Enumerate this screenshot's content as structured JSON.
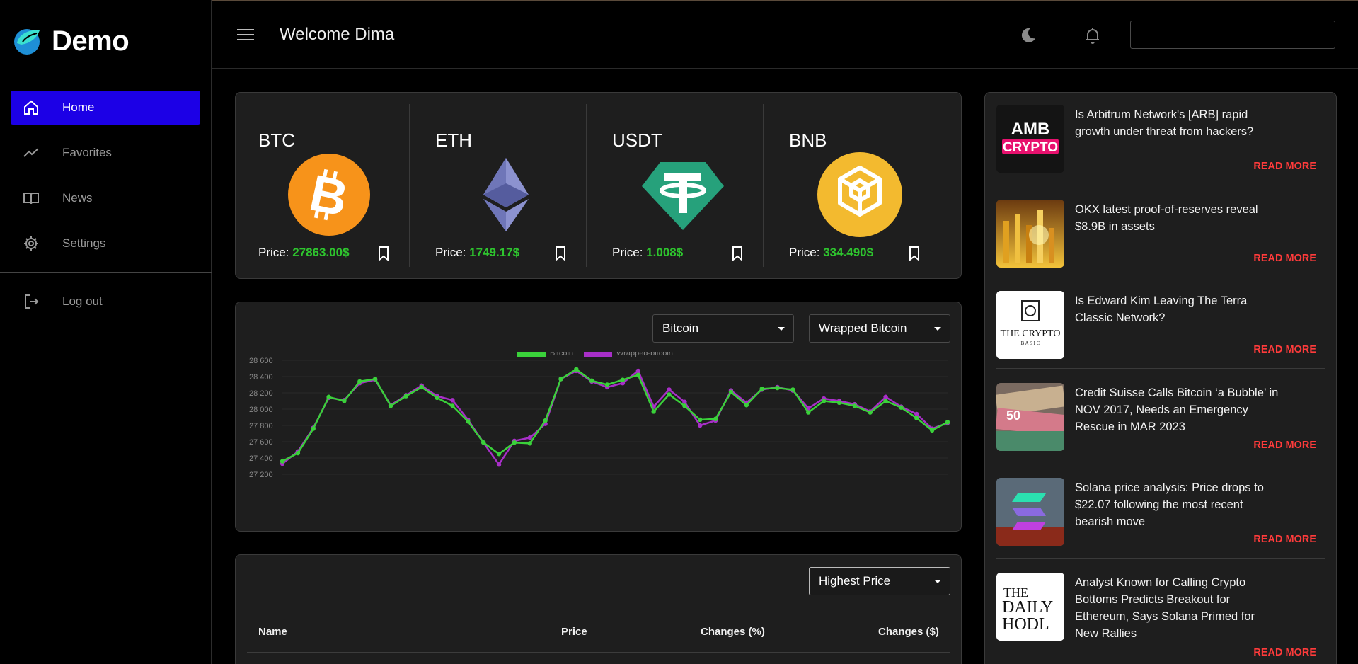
{
  "app": {
    "brand": "Demo"
  },
  "sidebar": {
    "items": [
      {
        "label": "Home",
        "icon": "home-icon",
        "active": true
      },
      {
        "label": "Favorites",
        "icon": "trend-icon",
        "active": false
      },
      {
        "label": "News",
        "icon": "book-icon",
        "active": false
      },
      {
        "label": "Settings",
        "icon": "gear-icon",
        "active": false
      }
    ],
    "logout_label": "Log out"
  },
  "header": {
    "welcome": "Welcome Dima",
    "search_value": ""
  },
  "coins": [
    {
      "symbol": "BTC",
      "price_label": "Price: ",
      "price": "27863.00$",
      "color": "#f7931a"
    },
    {
      "symbol": "ETH",
      "price_label": "Price: ",
      "price": "1749.17$",
      "color": "#627eea"
    },
    {
      "symbol": "USDT",
      "price_label": "Price: ",
      "price": "1.008$",
      "color": "#26a17b"
    },
    {
      "symbol": "BNB",
      "price_label": "Price: ",
      "price": "334.490$",
      "color": "#f3ba2f"
    }
  ],
  "chart_controls": {
    "select_a": "Bitcoin",
    "select_b": "Wrapped Bitcoin"
  },
  "chart_data": {
    "type": "line",
    "ylim": [
      27200,
      28600
    ],
    "yticks": [
      "28 600",
      "28 400",
      "28 200",
      "28 000",
      "27 800",
      "27 600",
      "27 400",
      "27 200"
    ],
    "legend_position": "top",
    "series": [
      {
        "name": "Bitcoin",
        "color": "#3ad13a",
        "values": [
          27360,
          27460,
          27760,
          28150,
          28100,
          28340,
          28370,
          28040,
          28160,
          28270,
          28140,
          28040,
          27850,
          27590,
          27450,
          27590,
          27580,
          27860,
          28370,
          28490,
          28350,
          28300,
          28360,
          28420,
          27970,
          28180,
          28040,
          27870,
          27880,
          28210,
          28050,
          28250,
          28260,
          28240,
          27960,
          28100,
          28080,
          28040,
          27960,
          28100,
          28020,
          27890,
          27740,
          27840
        ]
      },
      {
        "name": "Wrapped-bitcoin",
        "color": "#a82fc8",
        "values": [
          27330,
          27480,
          27770,
          28140,
          28110,
          28320,
          28360,
          28050,
          28170,
          28290,
          28160,
          28110,
          27870,
          27590,
          27320,
          27610,
          27650,
          27820,
          28370,
          28470,
          28340,
          28270,
          28320,
          28470,
          28030,
          28240,
          28090,
          27800,
          27860,
          28230,
          28080,
          28240,
          28270,
          28230,
          28010,
          28130,
          28100,
          28060,
          27970,
          28150,
          28030,
          27940,
          27760,
          27830
        ]
      }
    ]
  },
  "table": {
    "sort_select": "Highest Price",
    "columns": [
      "Name",
      "Price",
      "Changes (%)",
      "Changes ($)"
    ]
  },
  "news": [
    {
      "title": "Is Arbitrum Network's [ARB] rapid growth under threat from hackers?",
      "read_more": "READ MORE",
      "thumb_text_1": "AMB",
      "thumb_text_2": "CRYPTO"
    },
    {
      "title": "OKX latest proof-of-reserves reveal $8.9B in assets",
      "read_more": "READ MORE"
    },
    {
      "title": "Is Edward Kim Leaving The Terra Classic Network?",
      "read_more": "READ MORE",
      "thumb_text_1": "THE CRYPTO",
      "thumb_text_2": "B A S I C"
    },
    {
      "title": "Credit Suisse Calls Bitcoin ‘a Bubble’ in NOV 2017, Needs an Emergency Rescue in MAR 2023",
      "read_more": "READ MORE",
      "thumb_text_1": "50"
    },
    {
      "title": "Solana price analysis: Price drops to $22.07 following the most recent bearish move",
      "read_more": "READ MORE"
    },
    {
      "title": "Analyst Known for Calling Crypto Bottoms Predicts Breakout for Ethereum, Says Solana Primed for New Rallies",
      "read_more": "READ MORE",
      "thumb_text_1": "THE",
      "thumb_text_2": "DAILY",
      "thumb_text_3": "HODL"
    }
  ]
}
